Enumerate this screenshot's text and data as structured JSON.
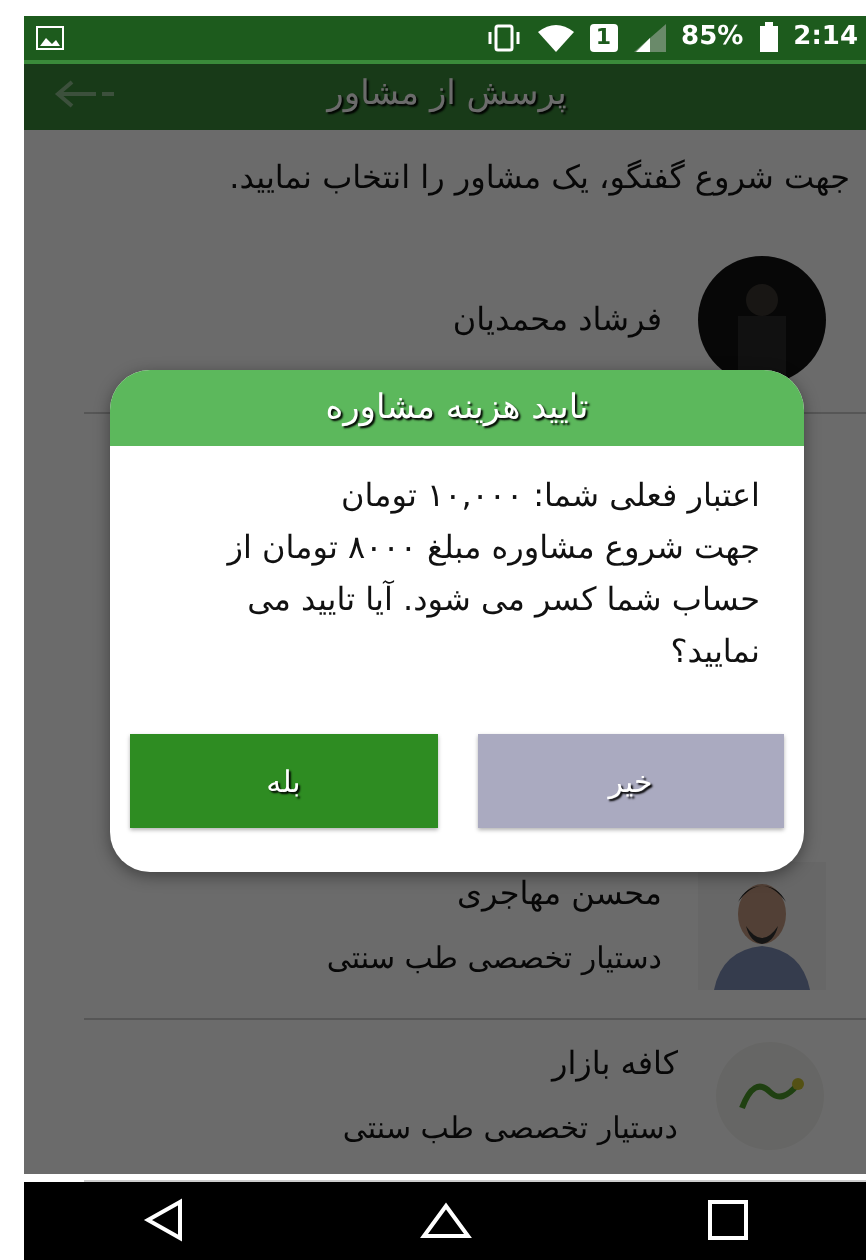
{
  "status_bar": {
    "sim_slot": "1",
    "battery": "85%",
    "time": "2:14"
  },
  "app_bar": {
    "title": "پرسش از مشاور"
  },
  "instruction": "جهت شروع گفتگو، یک مشاور را انتخاب نمایید.",
  "advisors": [
    {
      "name": "فرشاد محمدیان",
      "kind": "dark-photo"
    },
    {
      "name": "محسن مهاجری",
      "role": "دستیار تخصصی طب سنتی"
    },
    {
      "name": "کافه بازار",
      "role": "دستیار تخصصی طب سنتی",
      "kind": "logo"
    }
  ],
  "dialog": {
    "title": "تایید هزینه مشاوره",
    "lines": [
      "اعتبار فعلی شما: ۱۰,۰۰۰ تومان",
      "جهت شروع مشاوره مبلغ ۸۰۰۰ تومان از حساب شما کسر می شود. آیا تایید می نمایید؟"
    ],
    "buttons": [
      {
        "label": "خیر",
        "kind": "cancel"
      },
      {
        "label": "بله",
        "kind": "confirm"
      }
    ]
  }
}
